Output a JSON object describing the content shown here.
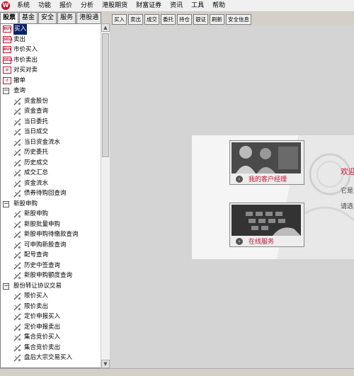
{
  "menubar": {
    "app_icon": "W",
    "items": [
      "系统",
      "功能",
      "报价",
      "分析",
      "港股期货",
      "财富证券",
      "资讯",
      "工具",
      "帮助"
    ]
  },
  "left_tabs": [
    "股票",
    "基金",
    "安全",
    "服务",
    "港股通"
  ],
  "tree": [
    {
      "label": "买入",
      "icon": "buy-icon",
      "icon_text": "BUY",
      "level": 0,
      "selected": true
    },
    {
      "label": "卖出",
      "icon": "sell-icon",
      "icon_text": "SELL",
      "level": 0
    },
    {
      "label": "市价买入",
      "icon": "buy-icon",
      "icon_text": "BUY",
      "level": 0
    },
    {
      "label": "市价卖出",
      "icon": "sell-icon",
      "icon_text": "SELL",
      "level": 0
    },
    {
      "label": "对买对卖",
      "icon": "trade-icon",
      "icon_text": "⇄",
      "level": 0
    },
    {
      "label": "撤单",
      "icon": "cancel-order-icon",
      "icon_text": "↺",
      "level": 0
    },
    {
      "label": "查询",
      "icon": "collapse-icon",
      "level": 0,
      "group": true
    },
    {
      "label": "资金股份",
      "icon": "leaf-icon",
      "level": 1
    },
    {
      "label": "资金查询",
      "icon": "leaf-icon",
      "level": 1
    },
    {
      "label": "当日委托",
      "icon": "leaf-icon",
      "level": 1
    },
    {
      "label": "当日成交",
      "icon": "leaf-icon",
      "level": 1
    },
    {
      "label": "当日资金流水",
      "icon": "leaf-icon",
      "level": 1
    },
    {
      "label": "历史委托",
      "icon": "leaf-icon",
      "level": 1
    },
    {
      "label": "历史成交",
      "icon": "leaf-icon",
      "level": 1
    },
    {
      "label": "成交汇总",
      "icon": "leaf-icon",
      "level": 1
    },
    {
      "label": "资金流水",
      "icon": "leaf-icon",
      "level": 1
    },
    {
      "label": "债券待购回查询",
      "icon": "leaf-icon",
      "level": 1
    },
    {
      "label": "新股申购",
      "icon": "collapse-icon",
      "level": 0,
      "group": true
    },
    {
      "label": "新股申购",
      "icon": "leaf-icon",
      "level": 1
    },
    {
      "label": "新股批量申购",
      "icon": "leaf-icon",
      "level": 1
    },
    {
      "label": "新股申购待缴款查询",
      "icon": "leaf-icon",
      "level": 1
    },
    {
      "label": "可申购新股查询",
      "icon": "leaf-icon",
      "level": 1
    },
    {
      "label": "配号查询",
      "icon": "leaf-icon",
      "level": 1
    },
    {
      "label": "历史中签查询",
      "icon": "leaf-icon",
      "level": 1
    },
    {
      "label": "新股申购额度查询",
      "icon": "leaf-icon",
      "level": 1
    },
    {
      "label": "股份转让协议交易",
      "icon": "collapse-icon",
      "level": 0,
      "group": true
    },
    {
      "label": "限价买入",
      "icon": "leaf-icon",
      "level": 1
    },
    {
      "label": "限价卖出",
      "icon": "leaf-icon",
      "level": 1
    },
    {
      "label": "定价申报买入",
      "icon": "leaf-icon",
      "level": 1
    },
    {
      "label": "定价申报卖出",
      "icon": "leaf-icon",
      "level": 1
    },
    {
      "label": "集合竞价买入",
      "icon": "leaf-icon",
      "level": 1
    },
    {
      "label": "集合竞价卖出",
      "icon": "leaf-icon",
      "level": 1
    },
    {
      "label": "盘后大宗交易买入",
      "icon": "leaf-icon",
      "level": 1
    }
  ],
  "toolbar": [
    "买入",
    "卖出",
    "成交",
    "委托",
    "持仓",
    "银证",
    "刷新",
    "安全信息"
  ],
  "ad": {
    "card1_label": "我的客户经理",
    "card2_label": "在线服务",
    "welcome_text": "欢迎",
    "line1": "它是",
    "line2": "请选"
  },
  "colors": {
    "accent": "#c8102e",
    "selection": "#0a246a",
    "background": "#d4d4d4"
  }
}
